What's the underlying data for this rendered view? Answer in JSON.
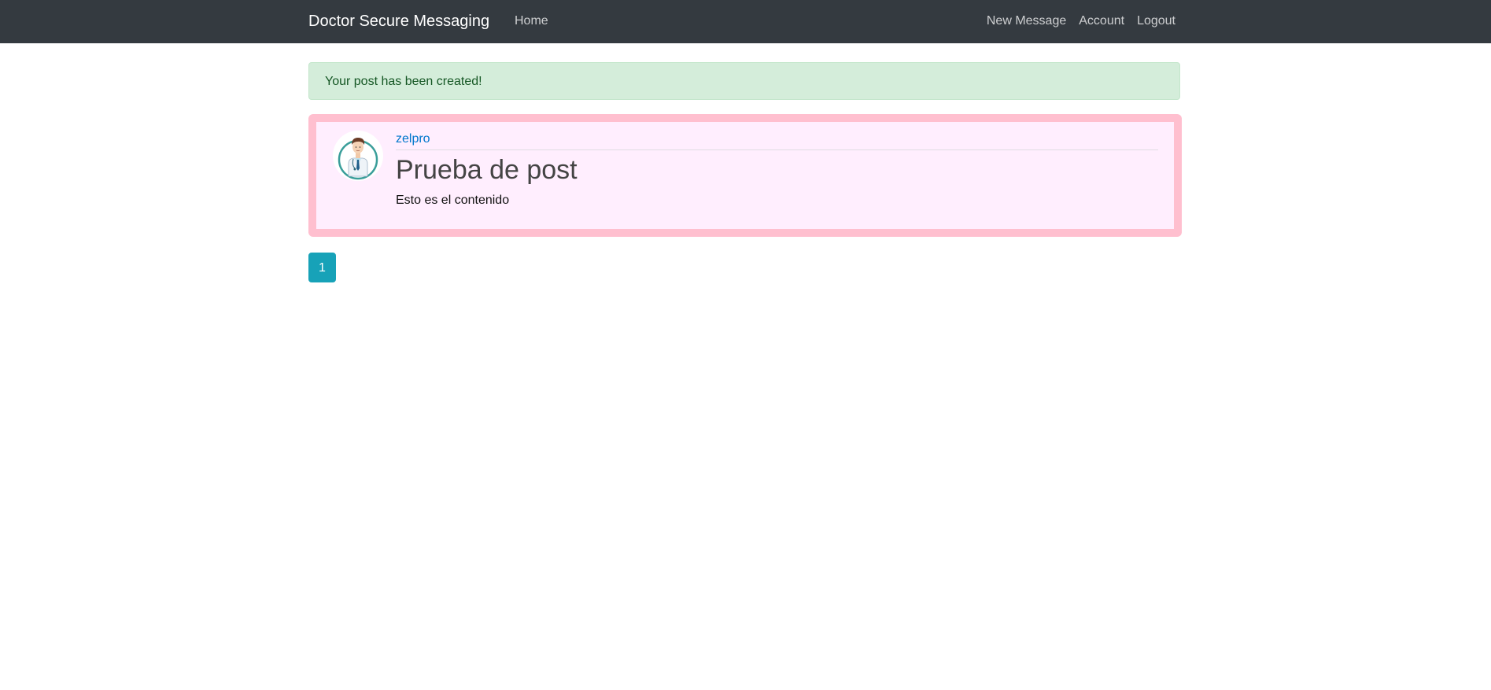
{
  "navbar": {
    "brand": "Doctor Secure Messaging",
    "home": "Home",
    "right_items": [
      "New Message",
      "Account",
      "Logout"
    ]
  },
  "alert": {
    "message": "Your post has been created!"
  },
  "post": {
    "author": "zelpro",
    "title": "Prueba de post",
    "content": "Esto es el contenido",
    "avatar_icon": "doctor-avatar-icon"
  },
  "pagination": {
    "current_page": "1"
  },
  "colors": {
    "navbar_bg": "#343a40",
    "alert_bg": "#d4edda",
    "alert_text": "#155724",
    "card_border": "#ffbfcf",
    "card_bg": "#ffeefe",
    "link": "#0077cc",
    "page_active": "#17a2b8"
  }
}
